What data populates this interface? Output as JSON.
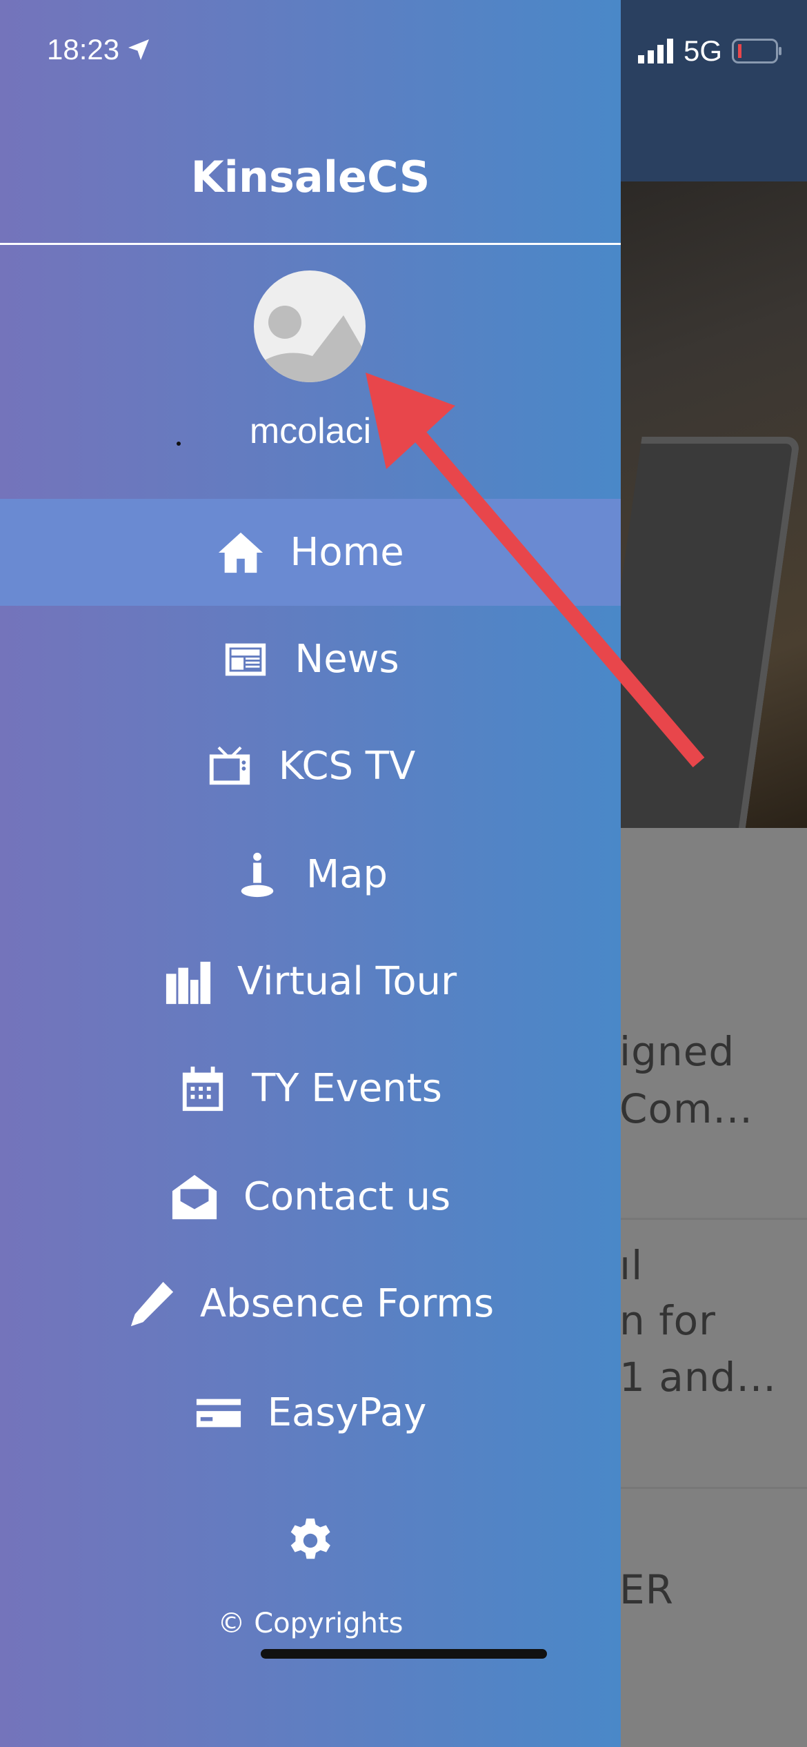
{
  "status_bar": {
    "time": "18:23",
    "network": "5G",
    "battery_level": "low"
  },
  "drawer": {
    "title": "KinsaleCS",
    "username": "mcolaci",
    "items": [
      {
        "label": "Home",
        "icon": "home-icon",
        "active": true
      },
      {
        "label": "News",
        "icon": "newspaper-icon"
      },
      {
        "label": "KCS TV",
        "icon": "tv-icon"
      },
      {
        "label": "Map",
        "icon": "person-pin-icon"
      },
      {
        "label": "Virtual Tour",
        "icon": "buildings-icon"
      },
      {
        "label": "TY Events",
        "icon": "calendar-icon"
      },
      {
        "label": "Contact us",
        "icon": "envelope-open-icon"
      },
      {
        "label": "Absence Forms",
        "icon": "pencil-icon"
      },
      {
        "label": "EasyPay",
        "icon": "credit-card-icon"
      }
    ],
    "settings_icon": "gear-icon",
    "copyright": "© Copyrights"
  },
  "background_content": {
    "lines": [
      "igned",
      "Com...",
      "ıl",
      "n for",
      "1 and...",
      "ER"
    ]
  },
  "colors": {
    "drawer_start": "#7474bb",
    "drawer_end": "#4a88c8",
    "active": "#6a8ad2",
    "annotation_arrow": "#e8464b"
  }
}
